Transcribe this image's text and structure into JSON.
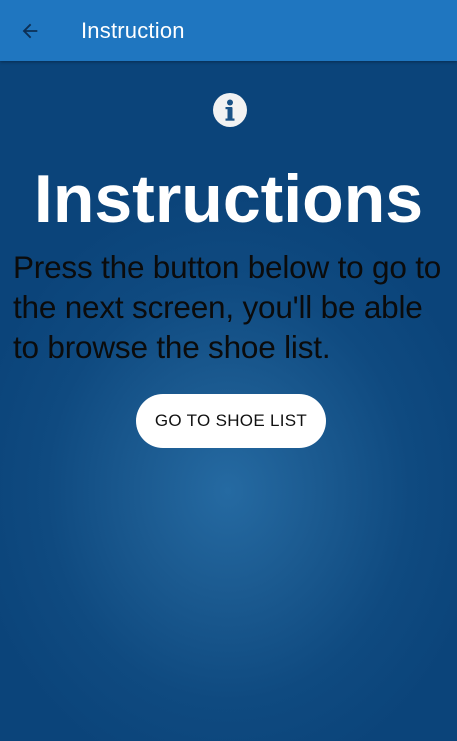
{
  "app_bar": {
    "title": "Instruction",
    "back_icon": "arrow-back-icon",
    "color": "#1f76c0"
  },
  "main": {
    "info_icon": "info-icon",
    "heading": "Instructions",
    "body": "Press the button below to go to the next screen, you'll be able to browse the shoe list.",
    "button_label": "GO TO SHOE LIST",
    "background_color": "#0f4a80"
  }
}
